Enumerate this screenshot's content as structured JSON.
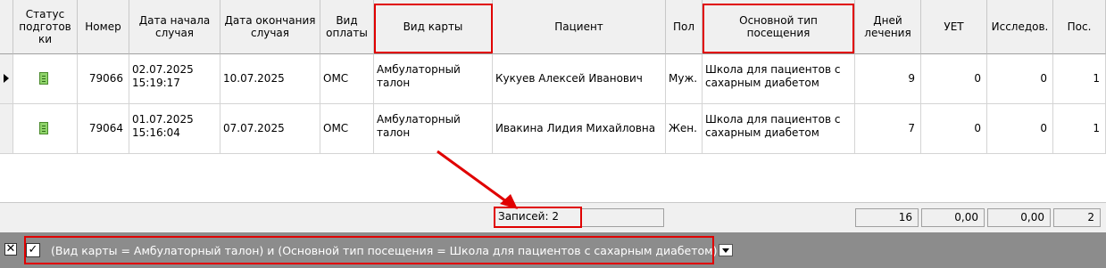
{
  "columns": [
    {
      "id": "status",
      "label": "Статус\nподготов\nки"
    },
    {
      "id": "number",
      "label": "Номер"
    },
    {
      "id": "start",
      "label": "Дата начала\nслучая"
    },
    {
      "id": "end",
      "label": "Дата окончания\nслучая"
    },
    {
      "id": "payment",
      "label": "Вид\nоплаты"
    },
    {
      "id": "card",
      "label": "Вид карты"
    },
    {
      "id": "patient",
      "label": "Пациент"
    },
    {
      "id": "sex",
      "label": "Пол"
    },
    {
      "id": "visit",
      "label": "Основной тип\nпосещения"
    },
    {
      "id": "days",
      "label": "Дней\nлечения"
    },
    {
      "id": "uet",
      "label": "УЕТ"
    },
    {
      "id": "research",
      "label": "Исследов."
    },
    {
      "id": "pos",
      "label": "Пос."
    }
  ],
  "rows": [
    {
      "number": "79066",
      "start": "02.07.2025\n15:19:17",
      "end": "10.07.2025",
      "payment": "ОМС",
      "card": "Амбулаторный\nталон",
      "patient": "Кукуев Алексей Иванович",
      "sex": "Муж.",
      "visit": "Школа для пациентов с\nсахарным диабетом",
      "days": "9",
      "uet": "0",
      "research": "0",
      "pos": "1",
      "status_icon": "document-green-icon",
      "current": true
    },
    {
      "number": "79064",
      "start": "01.07.2025\n15:16:04",
      "end": "07.07.2025",
      "payment": "ОМС",
      "card": "Амбулаторный\nталон",
      "patient": "Ивакина Лидия Михайловна",
      "sex": "Жен.",
      "visit": "Школа для пациентов с\nсахарным диабетом",
      "days": "7",
      "uet": "0",
      "research": "0",
      "pos": "1",
      "status_icon": "document-green-icon",
      "current": false
    }
  ],
  "footer": {
    "records": "Записей: 2",
    "days_total": "16",
    "uet_total": "0,00",
    "research_total": "0,00",
    "pos_total": "2"
  },
  "filter": {
    "text": "(Вид карты = Амбулаторный талон) и (Основной тип посещения = Школа для пациентов с сахарным диабетом)",
    "checked": true
  },
  "colors": {
    "highlight": "#e00000",
    "filterbar": "#8c8c8c",
    "header": "#f0f0f0",
    "icon": "#8fd36a"
  }
}
